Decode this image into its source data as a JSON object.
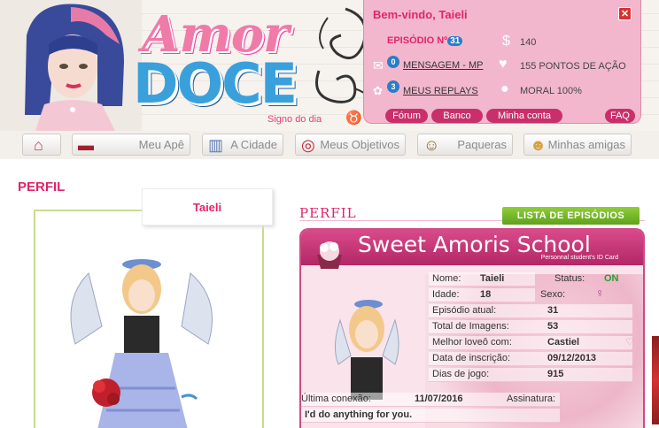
{
  "brand": {
    "line1": "Amor",
    "line2": "DOCE",
    "signo": "Signo do dia"
  },
  "welcome": {
    "title": "Bem-vindo, Taieli",
    "episode_label": "EPISÓDIO Nº",
    "episode_number": "31",
    "messages_count": "0",
    "messages_label": "MENSAGEM - MP",
    "replays_count": "3",
    "replays_label": "MEUS REPLAYS",
    "money": "140",
    "action_points": "155 PONTOS DE AÇÃO",
    "morale": "MORAL 100%",
    "buttons": [
      "Fórum",
      "Banco",
      "Minha conta",
      "FAQ"
    ]
  },
  "nav": [
    {
      "label": "",
      "icon": "home-icon"
    },
    {
      "label": "Meu Apê",
      "icon": "sofa-icon"
    },
    {
      "label": "A Cidade",
      "icon": "building-icon"
    },
    {
      "label": "Meus Objetivos",
      "icon": "target-icon"
    },
    {
      "label": "Paqueras",
      "icon": "boy-icon"
    },
    {
      "label": "Minhas amigas",
      "icon": "girl-icon"
    }
  ],
  "page": {
    "title": "PERFIL",
    "tab_name": "Taieli",
    "section_title": "PERFIL",
    "list_button": "LISTA DE EPISÓDIOS"
  },
  "card": {
    "title": "Sweet Amoris School",
    "subtitle": "Personnal student's ID Card",
    "fields": {
      "name_label": "Nome:",
      "name_value": "Taieli",
      "status_label": "Status:",
      "status_value": "ON",
      "age_label": "Idade:",
      "age_value": "18",
      "sex_label": "Sexo:",
      "sex_value": "♀",
      "episode_label": "Episódio atual:",
      "episode_value": "31",
      "images_label": "Total de Imagens:",
      "images_value": "53",
      "best_label": "Melhor loveô com:",
      "best_value": "Castiel",
      "signup_label": "Data de inscrição:",
      "signup_value": "09/12/2013",
      "days_label": "Dias de jogo:",
      "days_value": "915",
      "last_label": "Última conexão:",
      "last_value": "11/07/2016",
      "signature_label": "Assinatura:",
      "signature_value": "I'd do anything for you."
    }
  },
  "colors": {
    "accent": "#e0256b",
    "panel": "#f3b7cd",
    "card_head": "#c2306f",
    "green": "#6db52a"
  }
}
